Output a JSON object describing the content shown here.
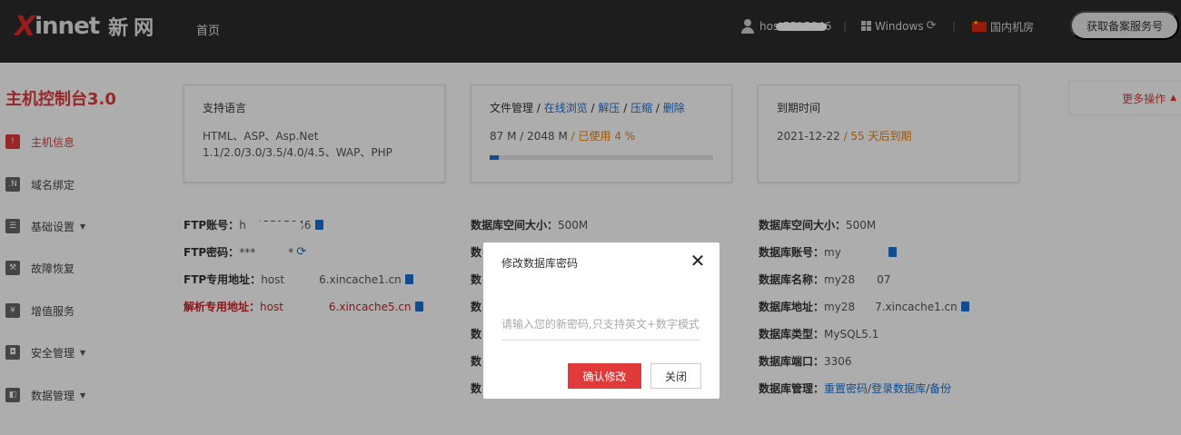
{
  "topbar": {
    "logo_x": "X",
    "logo_rest": "innet",
    "logo_cn": "新网",
    "nav_home": "首页",
    "username": "host5515846",
    "os": "Windows",
    "region": "国内机房",
    "record_button": "获取备案服务号"
  },
  "sidebar": {
    "title": "主机控制台3.0",
    "items": [
      {
        "label": "主机信息",
        "icon": "alert-icon"
      },
      {
        "label": "域名绑定",
        "icon": "net-icon"
      },
      {
        "label": "基础设置",
        "icon": "settings-icon",
        "has_caret": true
      },
      {
        "label": "故障恢复",
        "icon": "wrench-icon"
      },
      {
        "label": "增值服务",
        "icon": "money-icon"
      },
      {
        "label": "安全管理",
        "icon": "shield-icon",
        "has_caret": true
      },
      {
        "label": "数据管理",
        "icon": "data-icon",
        "has_caret": true
      }
    ]
  },
  "cards": {
    "lang": {
      "title": "支持语言",
      "line1": "HTML、ASP、Asp.Net",
      "line2": "1.1/2.0/3.0/3.5/4.0/4.5、WAP、PHP"
    },
    "files": {
      "title": "文件管理",
      "sep": " / ",
      "link_browse": "在线浏览",
      "link_unzip": "解压",
      "link_zip": "压缩",
      "link_delete": "删除",
      "usage": "87 M / 2048 M",
      "used_text": " / 已使用 4 %",
      "used_fraction": 0.04
    },
    "expire": {
      "title": "到期时间",
      "date": "2021-12-22",
      "remain": " / 55 天后到期"
    }
  },
  "more_ops": "更多操作",
  "ftp": {
    "account_label": "FTP账号：",
    "account_value": "host5515846",
    "password_label": "FTP密码：",
    "password_value": "***",
    "password_tail": "*",
    "address_label": "FTP专用地址：",
    "address_prefix": "host",
    "address_suffix": "6.xincache1.cn",
    "resolve_label": "解析专用地址：",
    "resolve_prefix": "host",
    "resolve_suffix": "6.xincache5.cn"
  },
  "db_mid": {
    "size_label": "数据库空间大小：",
    "size_value": "500M",
    "partial_label": "数"
  },
  "db_right": {
    "size_label": "数据库空间大小：",
    "size_value": "500M",
    "account_label": "数据库账号：",
    "account_prefix": "my",
    "name_label": "数据库名称：",
    "name_prefix": "my28",
    "name_suffix": "07",
    "address_label": "数据库地址：",
    "address_prefix": "my28",
    "address_suffix": "7.xincache1.cn",
    "type_label": "数据库类型：",
    "type_value": "MySQL5.1",
    "port_label": "数据库端口：",
    "port_value": "3306",
    "manage_label": "数据库管理：",
    "link_reset": "重置密码",
    "link_login": "登录数据库",
    "link_backup": "备份",
    "sep": " / "
  },
  "modal": {
    "title": "修改数据库密码",
    "close_glyph": "✕",
    "placeholder": "请输入您的新密码,只支持英文+数字模式",
    "confirm": "确认修改",
    "cancel": "关闭"
  }
}
